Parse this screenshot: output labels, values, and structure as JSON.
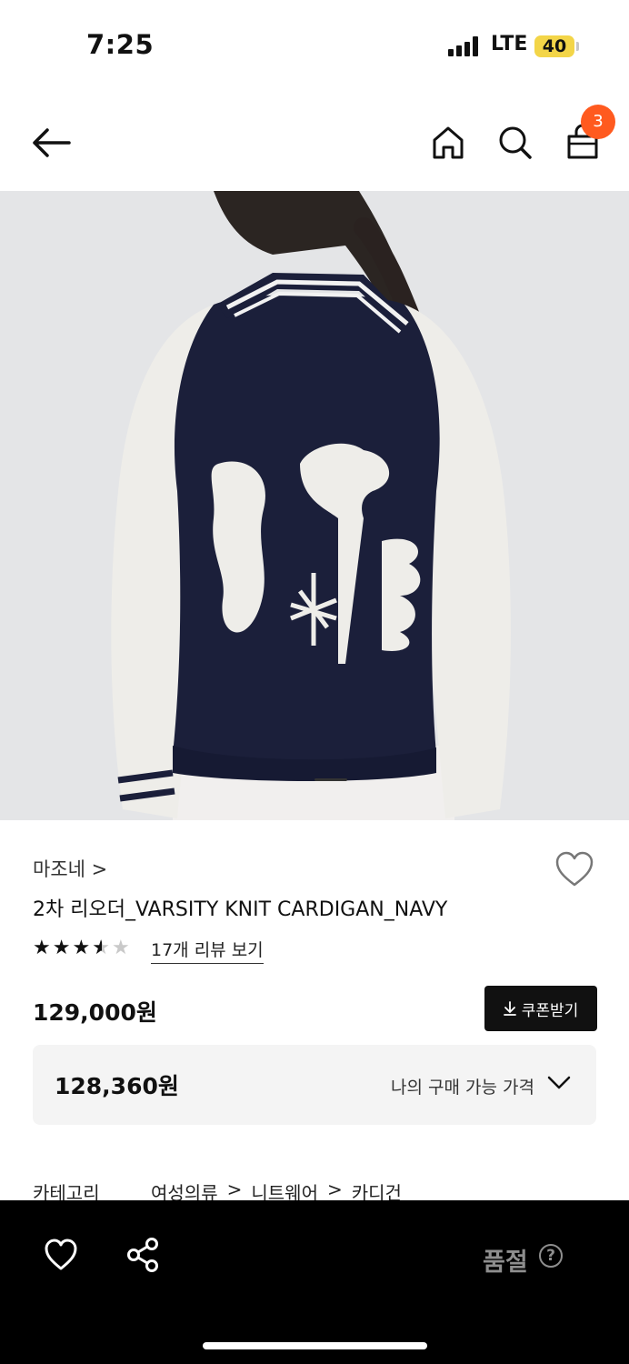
{
  "status": {
    "time": "7:25",
    "network": "LTE",
    "battery": "40"
  },
  "nav": {
    "cart_count": "3"
  },
  "product": {
    "brand": "마조네 >",
    "name": "2차 리오더_VARSITY KNIT CARDIGAN_NAVY",
    "rating": 3.5,
    "review_link": "17개 리뷰 보기",
    "price": "129,000원",
    "coupon_label": "쿠폰받기",
    "my_price": "128,360원",
    "my_price_label": "나의 구매 가능 가격"
  },
  "category": {
    "label": "카테고리",
    "path": [
      "여성의류",
      ">",
      "니트웨어",
      ">",
      "카디건"
    ]
  },
  "bottom": {
    "soldout_label": "품절",
    "help_symbol": "?"
  },
  "colors": {
    "badge": "#ff5a1f",
    "battery": "#f3d548",
    "navy": "#1b1f3a"
  }
}
